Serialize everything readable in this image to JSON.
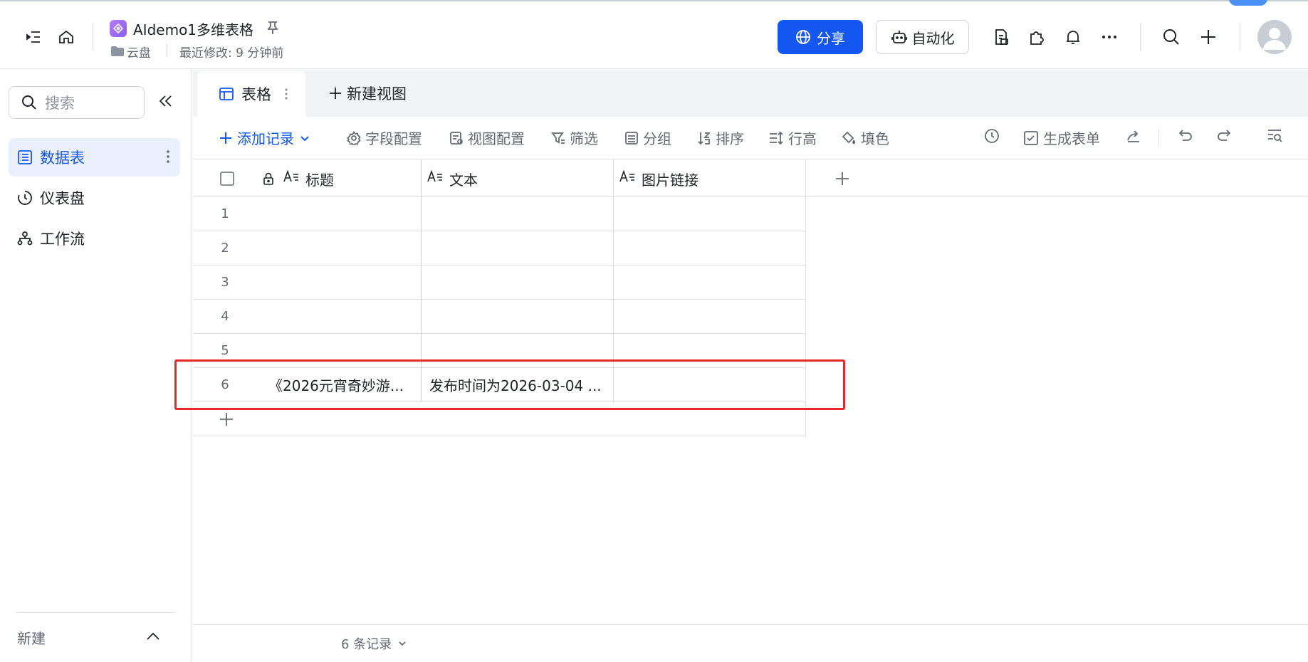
{
  "header": {
    "doc_title": "AIdemo1多维表格",
    "location": "云盘",
    "modified": "最近修改: 9 分钟前",
    "share_label": "分享",
    "automation_label": "自动化"
  },
  "sidebar": {
    "search_placeholder": "搜索",
    "items": [
      {
        "label": "数据表",
        "icon": "table-icon",
        "active": true
      },
      {
        "label": "仪表盘",
        "icon": "dashboard-icon",
        "active": false
      },
      {
        "label": "工作流",
        "icon": "workflow-icon",
        "active": false
      }
    ],
    "new_label": "新建"
  },
  "tabs": {
    "active_tab": "表格",
    "new_view": "新建视图"
  },
  "toolbar": {
    "add_record": "添加记录",
    "field_config": "字段配置",
    "view_config": "视图配置",
    "filter": "筛选",
    "group": "分组",
    "sort": "排序",
    "row_height": "行高",
    "fill_color": "填色",
    "generate_form": "生成表单"
  },
  "table": {
    "columns": [
      {
        "label": "标题",
        "type_icon": "text-field-icon",
        "locked": true
      },
      {
        "label": "文本",
        "type_icon": "text-field-icon",
        "locked": false
      },
      {
        "label": "图片链接",
        "type_icon": "text-field-icon",
        "locked": false
      }
    ],
    "rows": [
      {
        "num": "1",
        "title": "",
        "text": "",
        "image_link": ""
      },
      {
        "num": "2",
        "title": "",
        "text": "",
        "image_link": ""
      },
      {
        "num": "3",
        "title": "",
        "text": "",
        "image_link": ""
      },
      {
        "num": "4",
        "title": "",
        "text": "",
        "image_link": ""
      },
      {
        "num": "5",
        "title": "",
        "text": "",
        "image_link": ""
      },
      {
        "num": "6",
        "title": "《2026元宵奇妙游...",
        "text": "发布时间为2026-03-04 ...",
        "image_link": ""
      }
    ]
  },
  "footer": {
    "record_count": "6 条记录"
  },
  "colors": {
    "accent": "#1456f0",
    "highlight_border": "#e8272a",
    "active_nav_bg": "#eaf0fd"
  }
}
